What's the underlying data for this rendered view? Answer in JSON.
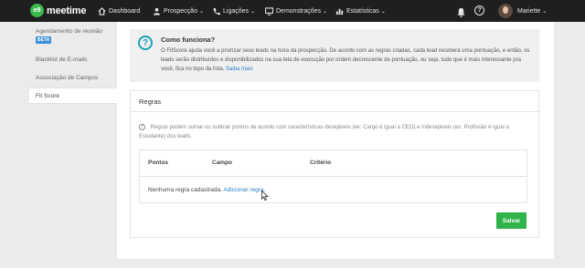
{
  "brand": {
    "logo_mark": "e9",
    "name": "meetime"
  },
  "nav": {
    "dashboard": "Dashboard",
    "prospeccao": "Prospecção",
    "ligacoes": "Ligações",
    "demonstracoes": "Demonstrações",
    "estatisticas": "Estatísticas",
    "caret": "⌄"
  },
  "user": {
    "name": "Mariette",
    "caret": "⌄"
  },
  "help_glyph": "?",
  "sidebar": {
    "items": [
      {
        "label": "Agendamento de reunião",
        "badge": "BETA"
      },
      {
        "label": "Blacklist de E-mails"
      },
      {
        "label": "Associação de Campos"
      }
    ],
    "active": "Fit Score"
  },
  "info": {
    "icon_glyph": "?",
    "title": "Como funciona?",
    "text": "O FitScore ajuda você a priorizar seus leads na hora da prospecção. De acordo com as regras criadas, cada lead receberá uma pontuação, e então, os leads serão distribuídos e disponibilizados na sua tela de execução por ordem decrescente de pontuação, ou seja, tudo que é mais interessante pra você, fica no topo da lista.",
    "link": "Saiba mais"
  },
  "rules": {
    "title": "Regras",
    "hint_glyph": "?",
    "hint": "Regras podem somar ou subtrair pontos de acordo com características desejáveis (ex: Cargo é igual a CEO) e indesejáveis (ex: Profissão é igual a Estudante) dos leads.",
    "columns": [
      "Pontos",
      "Campo",
      "Critério"
    ],
    "empty_text": "Nenhuma regra cadastrada.",
    "add_link": "Adicionar regra."
  },
  "save_label": "Salvar",
  "colors": {
    "brand_green": "#3cb84e",
    "save_green": "#2fb34a",
    "info_accent": "#1ba3b5",
    "link": "#2d7ec4",
    "topbar": "#1f1f1f"
  }
}
